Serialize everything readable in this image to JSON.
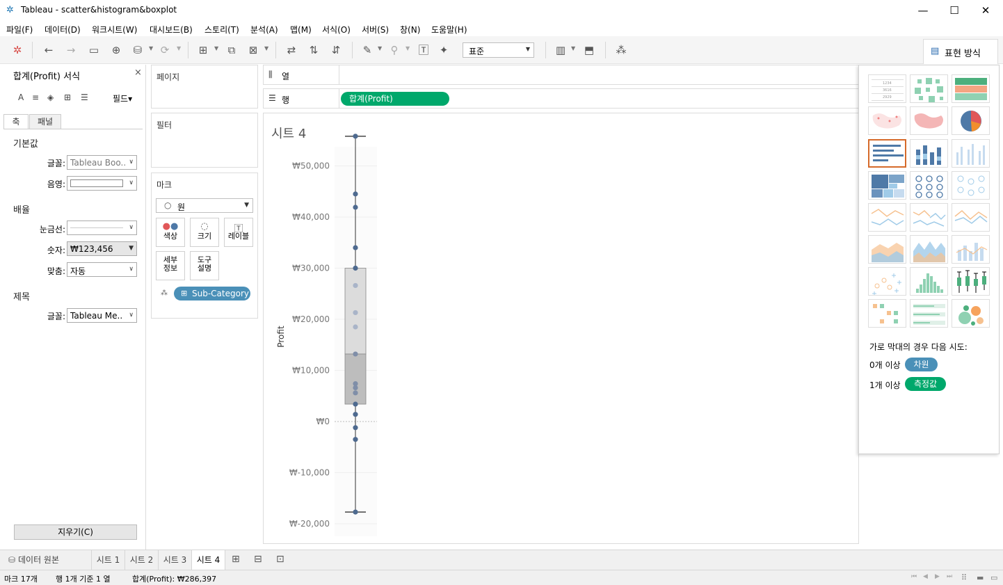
{
  "window": {
    "title": "Tableau - scatter&histogram&boxplot",
    "controls": [
      "—",
      "☐",
      "✕"
    ]
  },
  "menu": [
    "파일(F)",
    "데이터(D)",
    "워크시트(W)",
    "대시보드(B)",
    "스토리(T)",
    "분석(A)",
    "맵(M)",
    "서식(O)",
    "서버(S)",
    "창(N)",
    "도움말(H)"
  ],
  "toolbar": {
    "fit_value": "표준",
    "show_me_label": "표현 방식"
  },
  "format_pane": {
    "title": "합계(Profit) 서식",
    "close": "×",
    "field_dropdown": "필드▾",
    "tabs": [
      "축",
      "패널"
    ],
    "sections": {
      "default": "기본값",
      "scale": "배율",
      "title": "제목"
    },
    "labels": {
      "font": "글꼴:",
      "shading": "음영:",
      "tick_marks": "눈금선:",
      "numbers": "숫자:",
      "alignment": "맞춤:",
      "title_font": "글꼴:"
    },
    "values": {
      "font": "Tableau Boo..",
      "numbers": "₩123,456",
      "alignment": "자동",
      "title_font": "Tableau Me.."
    },
    "clear_button": "지우기(C)"
  },
  "cards": {
    "pages": "페이지",
    "filters": "필터",
    "marks": "마크",
    "mark_type": "원",
    "mark_buttons": [
      {
        "label": "색상"
      },
      {
        "label": "크기"
      },
      {
        "label": "레이블"
      },
      {
        "label": "세부\n정보"
      },
      {
        "label": "도구\n설명"
      }
    ],
    "detail_pill": "Sub-Category"
  },
  "shelves": {
    "columns_label": "열",
    "rows_label": "행",
    "rows_pill": "합계(Profit)"
  },
  "view": {
    "sheet_title": "시트 4"
  },
  "chart_data": {
    "type": "scatter",
    "subtype": "box-plot",
    "title": "",
    "xlabel": "",
    "ylabel": "Profit",
    "ylim": [
      -20000,
      57000
    ],
    "y_ticks": [
      -20000,
      -10000,
      0,
      10000,
      20000,
      30000,
      40000,
      50000
    ],
    "y_tick_labels": [
      "₩-20,000",
      "₩-10,000",
      "₩0",
      "₩10,000",
      "₩20,000",
      "₩30,000",
      "₩40,000",
      "₩50,000"
    ],
    "points": [
      55800,
      44500,
      41900,
      34000,
      30000,
      26600,
      21300,
      18500,
      13200,
      7400,
      6600,
      5600,
      3400,
      1400,
      -1200,
      -3500,
      -17700
    ],
    "box": {
      "lower_whisker": -17700,
      "q1": 3400,
      "median": 13200,
      "q3": 30000,
      "upper_whisker": 55800
    },
    "grid": true
  },
  "show_me": {
    "hint_title": "가로 막대의 경우 다음 시도:",
    "hint_rows": [
      {
        "prefix": "0개 이상",
        "pill": "차원",
        "color": "#4a90b8"
      },
      {
        "prefix": "1개 이상",
        "pill": "측정값",
        "color": "#00a86b"
      }
    ]
  },
  "sheet_tabs": [
    "데이터 원본",
    "시트 1",
    "시트 2",
    "시트 3",
    "시트 4"
  ],
  "status": {
    "marks": "마크 17개",
    "rows_cols": "행 1개 기준 1 열",
    "sum": "합계(Profit): ₩286,397"
  }
}
